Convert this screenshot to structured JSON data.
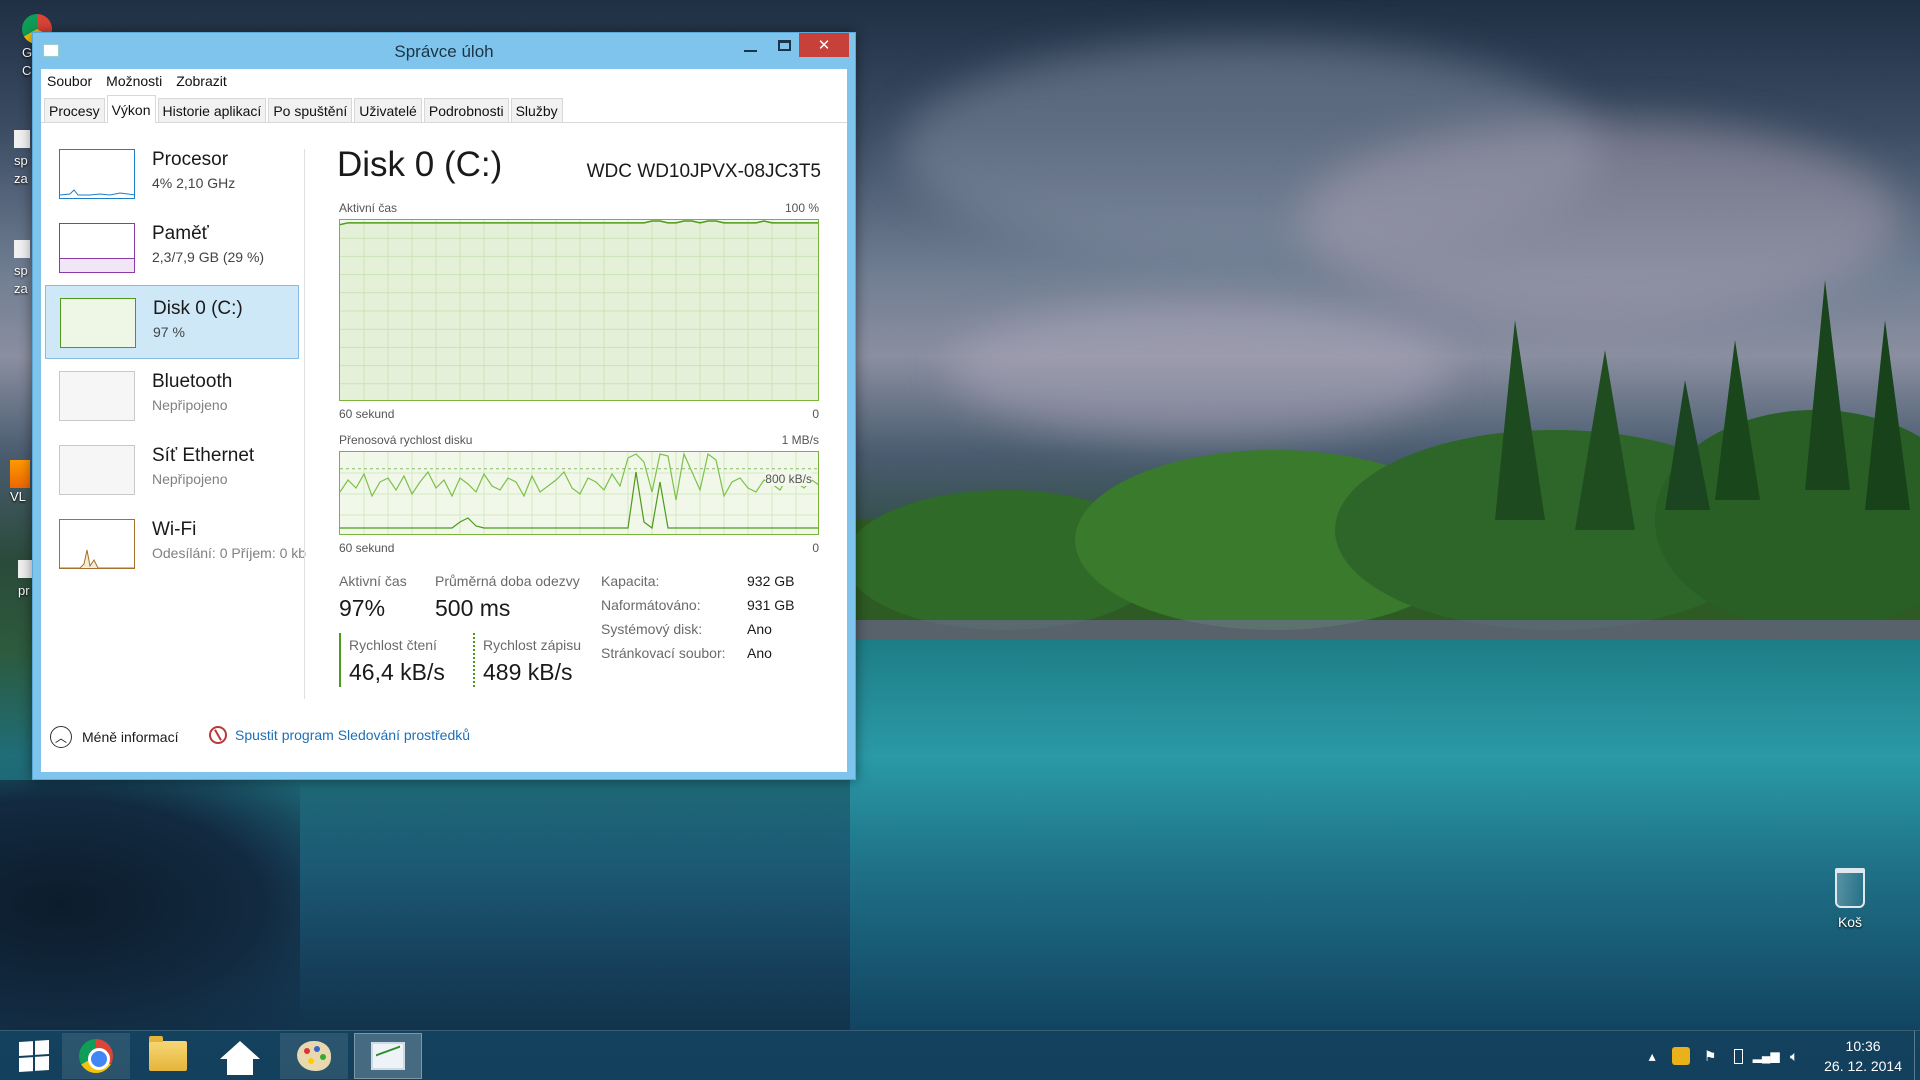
{
  "window": {
    "title": "Správce úloh",
    "close_glyph": "✕"
  },
  "menu": [
    "Soubor",
    "Možnosti",
    "Zobrazit"
  ],
  "tabs": [
    "Procesy",
    "Výkon",
    "Historie aplikací",
    "Po spuštění",
    "Uživatelé",
    "Podrobnosti",
    "Služby"
  ],
  "active_tab": "Výkon",
  "sidebar": {
    "items": [
      {
        "name": "Procesor",
        "sub": "4% 2,10 GHz",
        "color": "#1e7ec8"
      },
      {
        "name": "Paměť",
        "sub": "2,3/7,9 GB (29 %)",
        "color": "#8b3aa8"
      },
      {
        "name": "Disk 0 (C:)",
        "sub": "97 %",
        "color": "#4d9a1c"
      },
      {
        "name": "Bluetooth",
        "sub": "Nepřipojeno",
        "color": "#b0b0b0"
      },
      {
        "name": "Síť Ethernet",
        "sub": "Nepřipojeno",
        "color": "#b0b0b0"
      },
      {
        "name": "Wi-Fi",
        "sub": "Odesílání: 0 Příjem: 0 kb",
        "color": "#a5702a"
      }
    ]
  },
  "detail": {
    "title": "Disk 0 (C:)",
    "model": "WDC WD10JPVX-08JC3T5",
    "chart1": {
      "label": "Aktivní čas",
      "max_label": "100 %",
      "time_label": "60 sekund",
      "min_label": "0",
      "values": [
        98,
        99,
        99,
        99,
        99,
        99,
        99,
        99,
        99,
        99,
        99,
        99,
        99,
        99,
        99,
        99,
        99,
        99,
        99,
        99,
        99,
        99,
        99,
        99,
        99,
        99,
        99,
        99,
        99,
        99,
        99,
        99,
        99,
        99,
        99,
        99,
        99,
        99,
        99,
        100,
        100,
        99,
        99,
        100,
        100,
        99,
        100,
        100,
        99,
        99,
        99,
        99,
        99,
        100,
        99,
        99,
        99,
        99,
        99,
        99,
        99
      ]
    },
    "chart2": {
      "label": "Přenosová rychlost disku",
      "max_label": "1 MB/s",
      "time_label": "60 sekund",
      "min_label": "0",
      "ref_label": "800 kB/s"
    },
    "stats": {
      "active_label": "Aktivní čas",
      "active_value": "97%",
      "response_label": "Průměrná doba odezvy",
      "response_value": "500 ms",
      "read_label": "Rychlost čtení",
      "read_value": "46,4 kB/s",
      "write_label": "Rychlost zápisu",
      "write_value": "489 kB/s"
    },
    "props": [
      {
        "key": "Kapacita:",
        "value": "932 GB"
      },
      {
        "key": "Naformátováno:",
        "value": "931 GB"
      },
      {
        "key": "Systémový disk:",
        "value": "Ano"
      },
      {
        "key": "Stránkovací soubor:",
        "value": "Ano"
      }
    ]
  },
  "footer": {
    "less": "Méně informací",
    "resmon": "Spustit program Sledování prostředků"
  },
  "desktop": {
    "recycle_bin": "Koš",
    "left_fragments": [
      "G C",
      "sp za",
      "sp za",
      "VL",
      "pr"
    ]
  },
  "taskbar": {
    "time": "10:36",
    "date": "26. 12. 2014"
  }
}
